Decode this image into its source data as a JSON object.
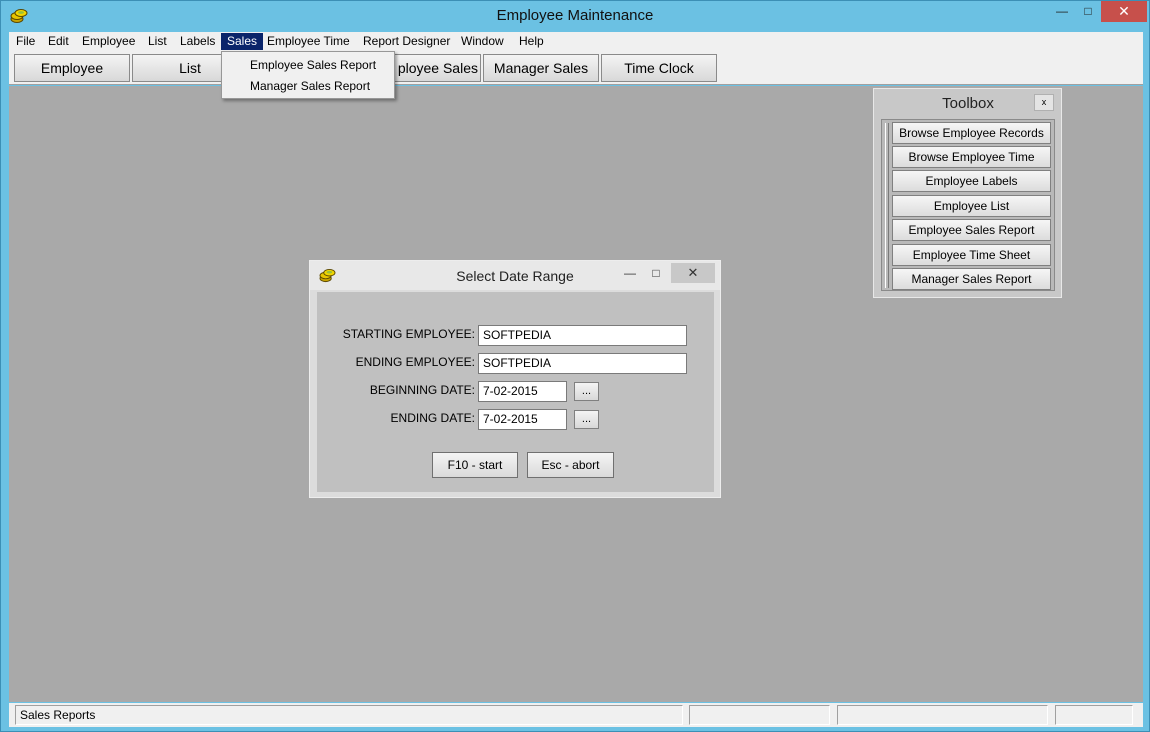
{
  "window": {
    "title": "Employee Maintenance",
    "minimize": "—",
    "maximize": "□",
    "close": "✕"
  },
  "menubar": {
    "items": [
      "File",
      "Edit",
      "Employee",
      "List",
      "Labels",
      "Sales",
      "Employee Time",
      "Report Designer",
      "Window",
      "Help"
    ],
    "active": "Sales"
  },
  "toolbar": {
    "buttons": [
      "Employee",
      "List",
      "ployee Sales",
      "Manager Sales",
      "Time Clock"
    ]
  },
  "sales_menu": {
    "items": [
      "Employee Sales Report",
      "Manager Sales Report"
    ]
  },
  "toolbox": {
    "title": "Toolbox",
    "close": "x",
    "buttons": [
      "Browse Employee Records",
      "Browse Employee Time",
      "Employee Labels",
      "Employee List",
      "Employee Sales Report",
      "Employee Time Sheet",
      "Manager Sales Report"
    ]
  },
  "dialog": {
    "title": "Select Date Range",
    "minimize": "—",
    "maximize": "□",
    "close": "✕",
    "starting_employee_label": "STARTING EMPLOYEE:",
    "starting_employee_value": "SOFTPEDIA",
    "ending_employee_label": "ENDING EMPLOYEE:",
    "ending_employee_value": "SOFTPEDIA",
    "beginning_date_label": "BEGINNING DATE:",
    "beginning_date_value": "7-02-2015",
    "ending_date_label": "ENDING DATE:",
    "ending_date_value": "7-02-2015",
    "picker_label": "...",
    "start_button": "F10 - start",
    "abort_button": "Esc - abort"
  },
  "statusbar": {
    "panes": [
      "Sales Reports",
      "",
      "",
      ""
    ]
  },
  "colors": {
    "frame": "#6bc1e3",
    "workspace": "#a9a9a9",
    "menu_highlight": "#0a246a",
    "close_button": "#c7504b"
  },
  "icons": {
    "app": "coin-stack-icon",
    "dialog": "coin-stack-icon"
  }
}
